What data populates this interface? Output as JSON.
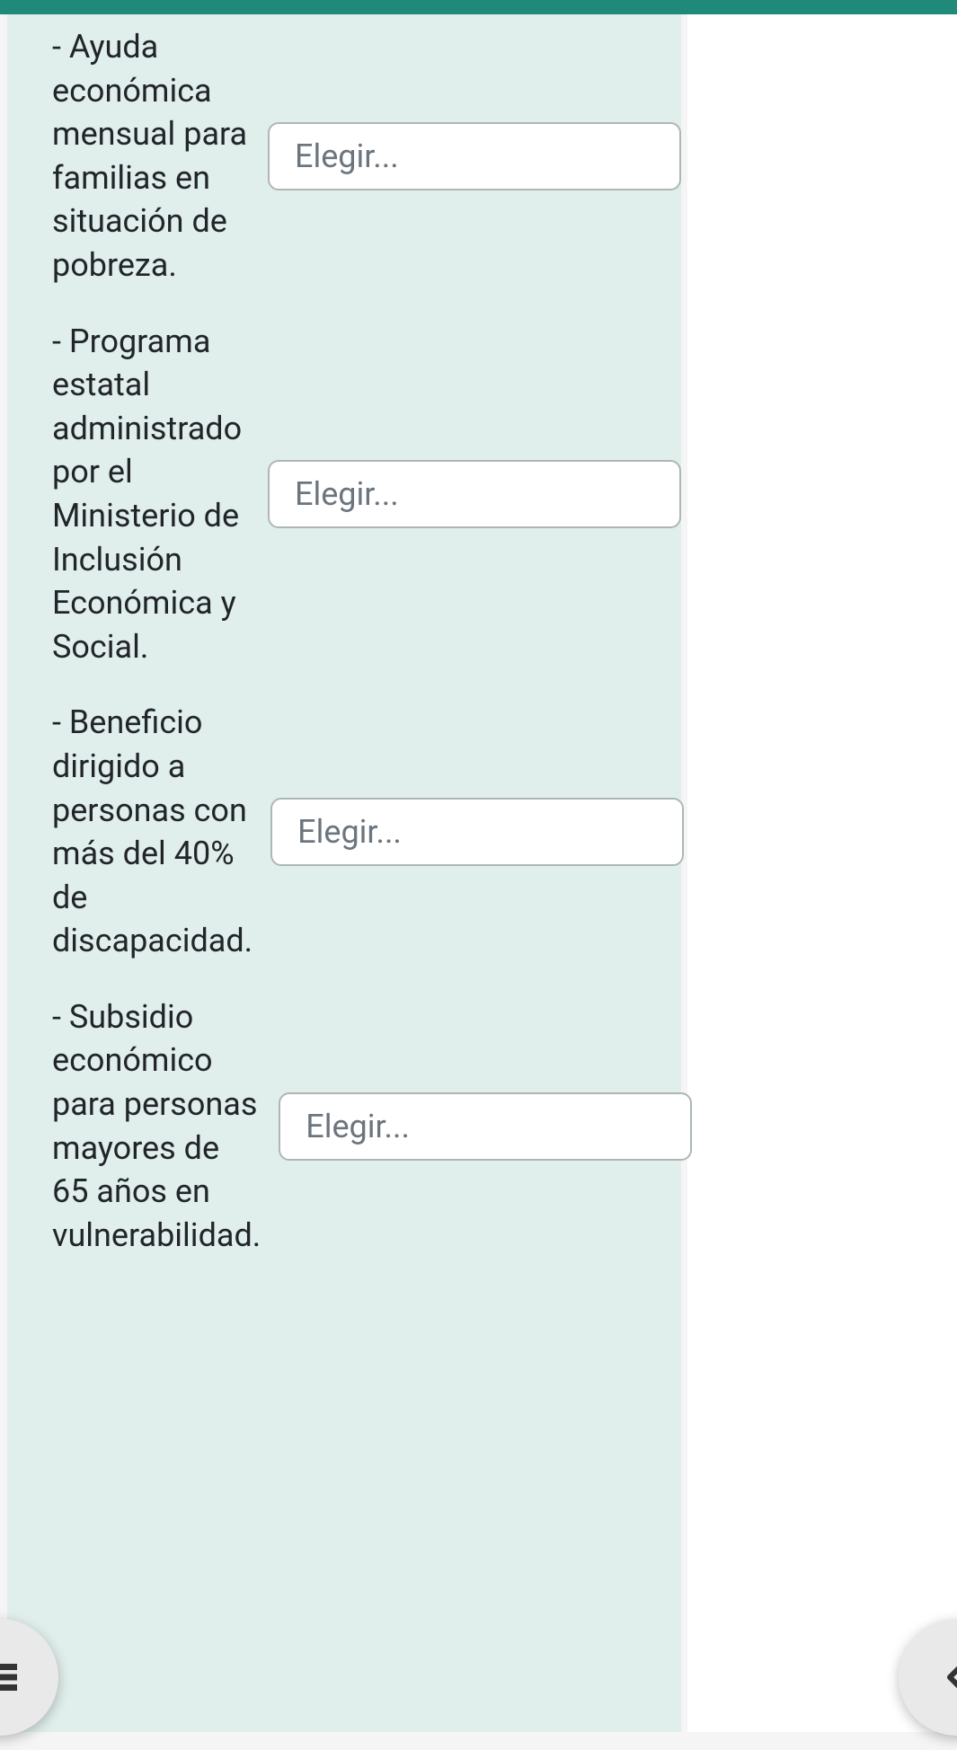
{
  "colors": {
    "accent": "#1f8a7a",
    "card_bg": "#e0eeec",
    "text": "#212529",
    "placeholder": "#6c757d",
    "select_border": "#aeb7b5",
    "fab_bg": "#e9e9e9"
  },
  "select_placeholder": "Elegir...",
  "rows": [
    {
      "label": "- Ayuda económica mensual para familias en situación de pobreza."
    },
    {
      "label": "- Programa estatal administrado por el Ministerio de Inclusión Económica y Social."
    },
    {
      "label": "- Beneficio dirigido a personas con más del 40% de discapacidad."
    },
    {
      "label": "- Subsidio económico para personas mayores de 65 años en vulnerabilidad."
    }
  ],
  "icons": {
    "list": "list-icon",
    "chevron_left": "chevron-left-icon"
  }
}
